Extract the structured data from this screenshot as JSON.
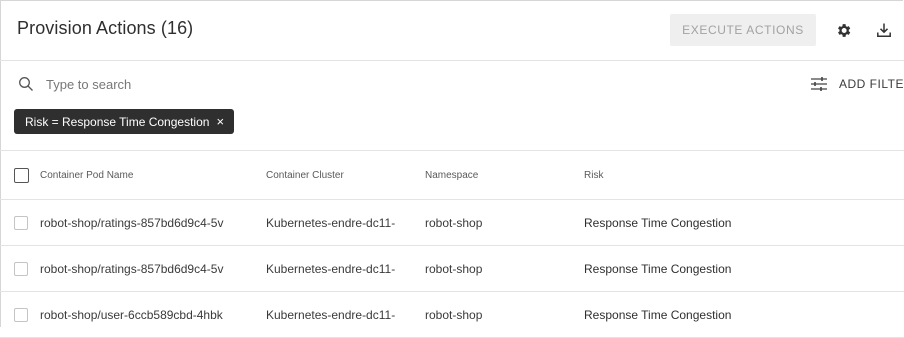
{
  "header": {
    "title": "Provision Actions (16)",
    "execute_label": "EXECUTE ACTIONS",
    "gear_icon": "gear-icon",
    "download_icon": "download-icon"
  },
  "search": {
    "placeholder": "Type to search",
    "value": "",
    "search_icon": "search-icon",
    "filter_icon": "sliders-icon",
    "add_filter_label": "ADD FILTER"
  },
  "filters": [
    {
      "label": "Risk = Response Time Congestion",
      "close": "×"
    }
  ],
  "table": {
    "columns": [
      "Container Pod Name",
      "Container Cluster",
      "Namespace",
      "Risk"
    ],
    "rows": [
      {
        "pod": "robot-shop/ratings-857bd6d9c4-5v",
        "cluster": "Kubernetes-endre-dc11-",
        "namespace": "robot-shop",
        "risk": "Response Time Congestion"
      },
      {
        "pod": "robot-shop/ratings-857bd6d9c4-5v",
        "cluster": "Kubernetes-endre-dc11-",
        "namespace": "robot-shop",
        "risk": "Response Time Congestion"
      },
      {
        "pod": "robot-shop/user-6ccb589cbd-4hbk",
        "cluster": "Kubernetes-endre-dc11-",
        "namespace": "robot-shop",
        "risk": "Response Time Congestion"
      }
    ]
  },
  "colors": {
    "chip_bg": "#2f2f2f",
    "disabled_button_bg": "#efefef",
    "disabled_button_text": "#a2a2a2"
  }
}
